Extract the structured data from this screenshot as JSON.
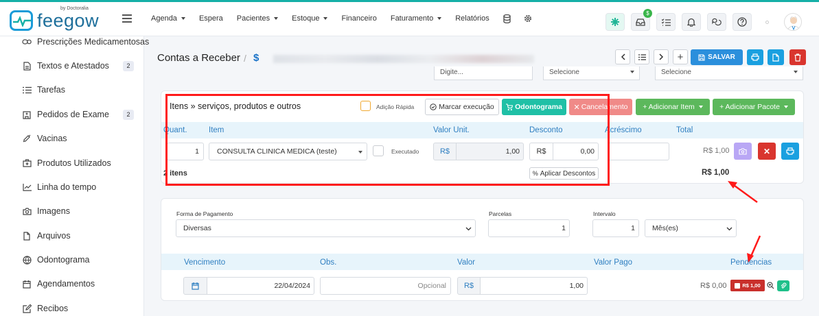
{
  "app": {
    "logo_text": "feegow",
    "logo_by": "by Doctoralia"
  },
  "nav": {
    "items": [
      {
        "label": "Agenda",
        "dropdown": true
      },
      {
        "label": "Espera",
        "dropdown": false
      },
      {
        "label": "Pacientes",
        "dropdown": true
      },
      {
        "label": "Estoque",
        "dropdown": true
      },
      {
        "label": "Financeiro",
        "dropdown": false
      },
      {
        "label": "Faturamento",
        "dropdown": true
      },
      {
        "label": "Relatórios",
        "dropdown": false
      }
    ],
    "icons": [
      "database-icon",
      "gear-icon"
    ]
  },
  "top_actions": {
    "icons": [
      "star-icon",
      "inbox-money-icon",
      "checklist-icon",
      "bell-icon",
      "chat-icon",
      "help-icon"
    ],
    "inbox_badge": "$"
  },
  "sidebar": {
    "items": [
      {
        "label": "Prescrições Medicamentosas",
        "icon": "pills-icon",
        "badge": ""
      },
      {
        "label": "Textos e Atestados",
        "icon": "document-icon",
        "badge": "2"
      },
      {
        "label": "Tarefas",
        "icon": "list-icon",
        "badge": ""
      },
      {
        "label": "Pedidos de Exame",
        "icon": "hospital-icon",
        "badge": "2"
      },
      {
        "label": "Vacinas",
        "icon": "syringe-icon",
        "badge": ""
      },
      {
        "label": "Produtos Utilizados",
        "icon": "medkit-icon",
        "badge": ""
      },
      {
        "label": "Linha do tempo",
        "icon": "chart-line-icon",
        "badge": ""
      },
      {
        "label": "Imagens",
        "icon": "camera-icon",
        "badge": ""
      },
      {
        "label": "Arquivos",
        "icon": "file-icon",
        "badge": ""
      },
      {
        "label": "Odontograma",
        "icon": "globe-icon",
        "badge": ""
      },
      {
        "label": "Agendamentos",
        "icon": "calendar-icon",
        "badge": ""
      },
      {
        "label": "Recibos",
        "icon": "edit-icon",
        "badge": ""
      }
    ]
  },
  "header": {
    "title": "Contas a Receber",
    "separator": "/",
    "dollar": "$",
    "save_label": "SALVAR",
    "plus_label": "+"
  },
  "top_fields": {
    "field1_placeholder": "Digite...",
    "select2_value": "Selecione",
    "select3_value": "Selecione"
  },
  "items": {
    "title": "Itens » serviços, produtos e outros",
    "quick_add_label": "Adição Rápida",
    "mark_exec_label": "Marcar execução",
    "odontograma_label": "Odontograma",
    "cancel_label": "Cancelamento",
    "add_item_label": "+ Adicionar Item",
    "add_package_label": "+ Adicionar Pacote",
    "columns": [
      "Quant.",
      "Item",
      "Valor Unit.",
      "Desconto",
      "Acréscimo",
      "Total"
    ],
    "row": {
      "qty": "1",
      "item": "CONSULTA CLINICA MEDICA (teste)",
      "executed_label": "Executado",
      "currency": "R$",
      "unit_value": "1,00",
      "discount": "0,00",
      "total": "R$ 1,00"
    },
    "count_label": "2 itens",
    "apply_discounts_label": "Aplicar Descontos",
    "grand_total": "R$ 1,00"
  },
  "payment": {
    "method_label": "Forma de Pagamento",
    "method_value": "Diversas",
    "installments_label": "Parcelas",
    "installments_value": "1",
    "interval_label": "Intervalo",
    "interval_value": "1",
    "interval_unit": "Mês(es)",
    "columns": [
      "Vencimento",
      "Obs.",
      "Valor",
      "Valor Pago",
      "Pendencias"
    ],
    "row": {
      "due_date": "22/04/2024",
      "obs_placeholder": "Opcional",
      "currency": "R$",
      "value": "1,00",
      "paid": "R$ 0,00",
      "pending_badge": "R$ 1,00"
    }
  },
  "colors": {
    "accent_blue": "#2b8fdc",
    "teal": "#1fc0a6",
    "danger": "#d9352e",
    "success": "#5cb85c",
    "annotation_red": "#ff1a1a"
  }
}
